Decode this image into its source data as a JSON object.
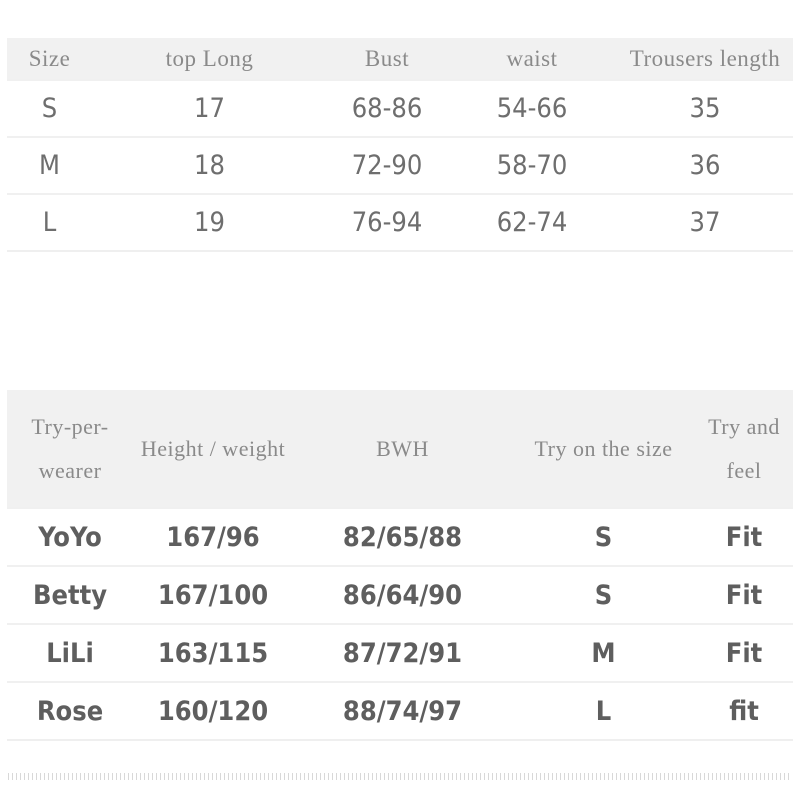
{
  "size_table": {
    "name": "size-chart",
    "headers": [
      "Size",
      "top Long",
      "Bust",
      "waist",
      "Trousers length"
    ],
    "rows": [
      [
        "S",
        "17",
        "68-86",
        "54-66",
        "35"
      ],
      [
        "M",
        "18",
        "72-90",
        "58-70",
        "36"
      ],
      [
        "L",
        "19",
        "76-94",
        "62-74",
        "37"
      ]
    ]
  },
  "tryon_table": {
    "name": "try-on-chart",
    "headers": [
      "Try-per-wearer",
      "Height / weight",
      "BWH",
      "Try on the size",
      "Try and feel"
    ],
    "rows": [
      [
        "YoYo",
        "167/96",
        "82/65/88",
        "S",
        "Fit"
      ],
      [
        "Betty",
        "167/100",
        "86/64/90",
        "S",
        "Fit"
      ],
      [
        "LiLi",
        "163/115",
        "87/72/91",
        "M",
        "Fit"
      ],
      [
        "Rose",
        "160/120",
        "88/74/97",
        "L",
        "fit"
      ]
    ]
  },
  "colors": {
    "header_background": "#f1f1f1",
    "header_text": "#8a8a8a",
    "body_text": "#6b6b6b",
    "row_divider": "#f0f0f0",
    "page_background": "#ffffff"
  }
}
